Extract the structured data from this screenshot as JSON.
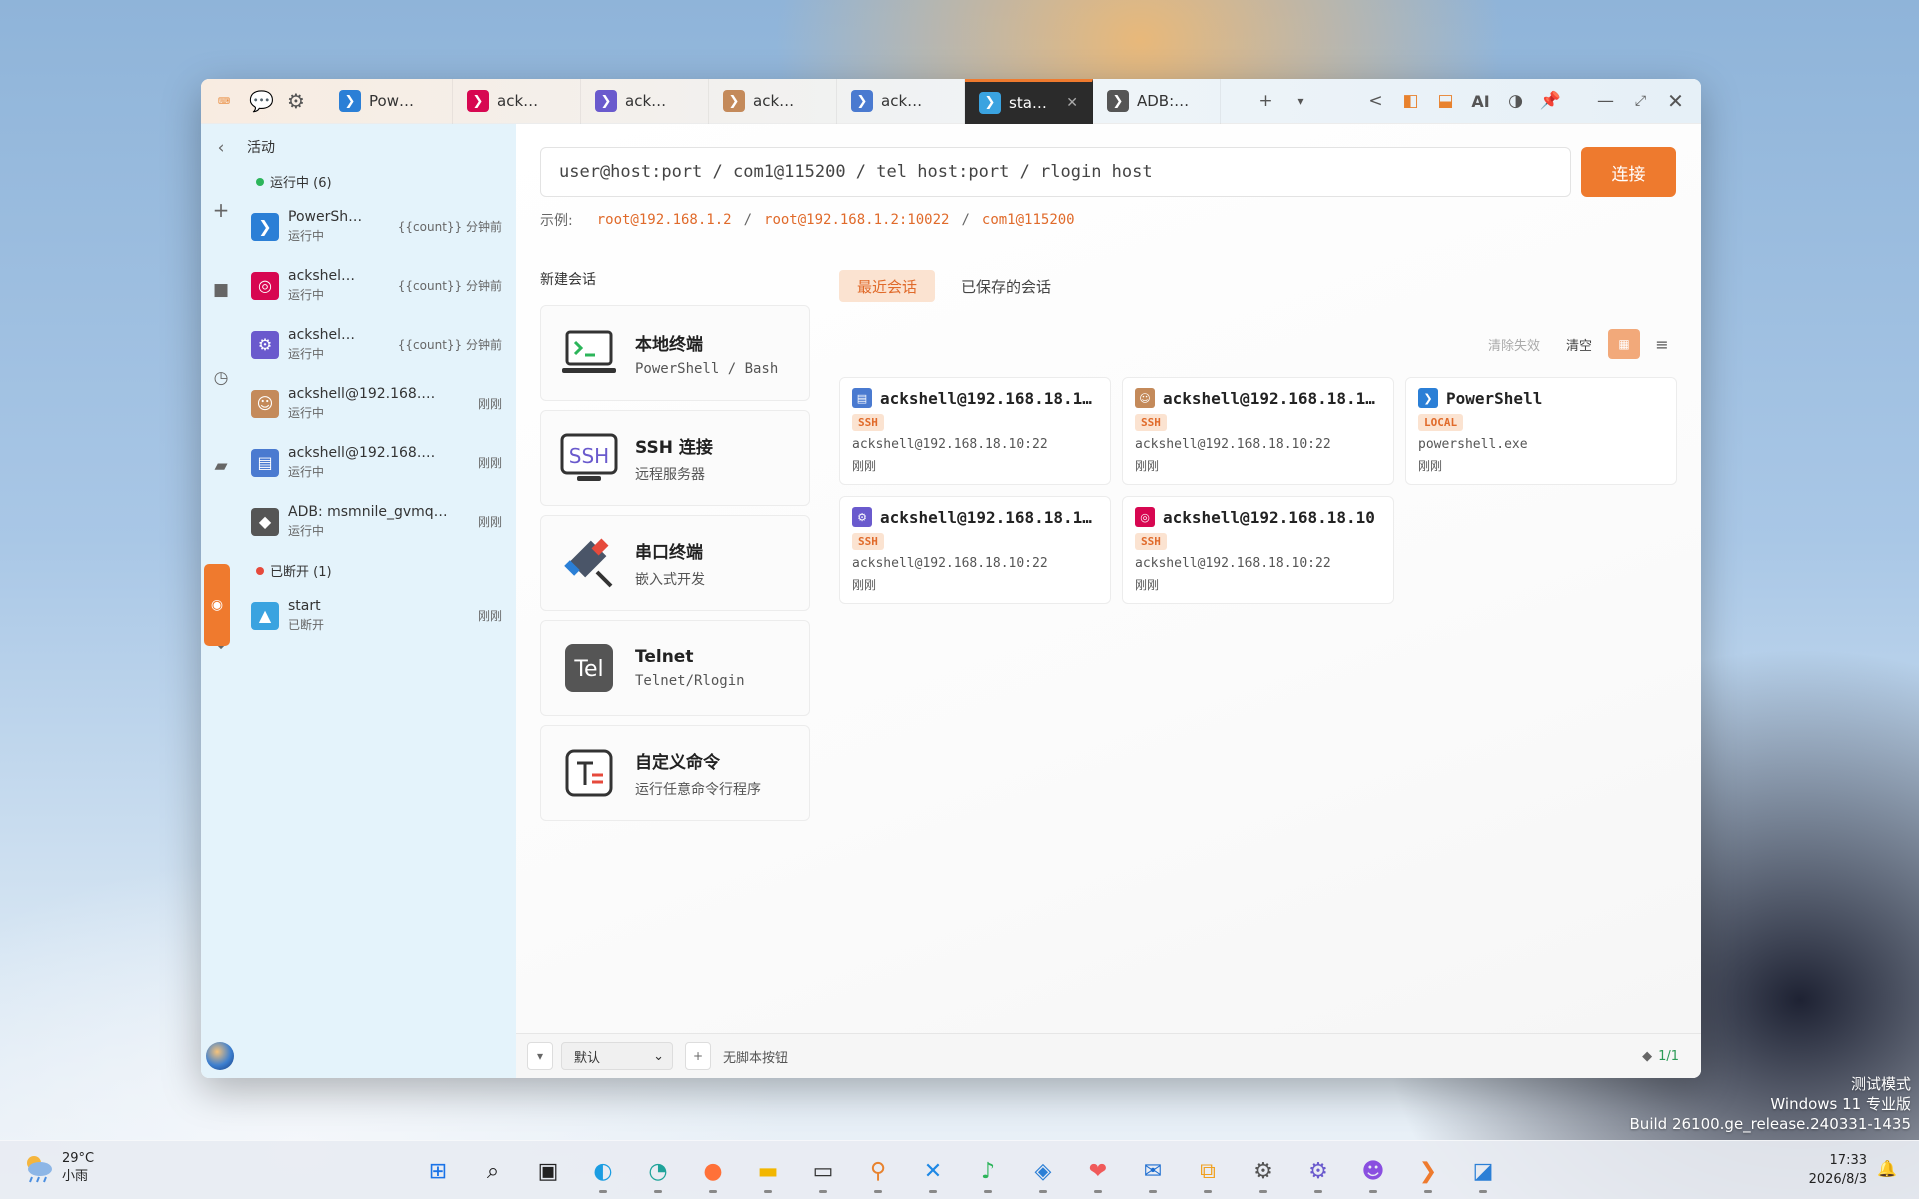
{
  "titlebar": {
    "icons": [
      "terminal-icon",
      "chat-icon",
      "gear-icon"
    ],
    "tabs": [
      {
        "label": "Pow…",
        "icon": "powershell-icon",
        "color": "#2b7fd6"
      },
      {
        "label": "ack…",
        "icon": "debian-icon",
        "color": "#d70751"
      },
      {
        "label": "ack…",
        "icon": "network-icon",
        "color": "#6a5acd"
      },
      {
        "label": "ack…",
        "icon": "avatar-icon",
        "color": "#c48a5a"
      },
      {
        "label": "ack…",
        "icon": "monitor-icon",
        "color": "#4a7ad0"
      },
      {
        "label": "sta…",
        "icon": "start-icon",
        "color": "#3aa3e0",
        "active": true
      },
      {
        "label": "ADB:…",
        "icon": "android-icon",
        "color": "#555555"
      }
    ],
    "right_buttons": {
      "add": "+",
      "dropdown": "▾",
      "back": "<",
      "ai": "AI"
    }
  },
  "sidebar": {
    "header": "活动",
    "running_title": "运行中 (6)",
    "running": [
      {
        "name": "PowerSh…",
        "status": "运行中",
        "time": "{{count}} 分钟前",
        "color": "#2b7fd6",
        "glyph": "❯"
      },
      {
        "name": "ackshel…",
        "status": "运行中",
        "time": "{{count}} 分钟前",
        "color": "#d70751",
        "glyph": "◎"
      },
      {
        "name": "ackshel…",
        "status": "运行中",
        "time": "{{count}} 分钟前",
        "color": "#6a5acd",
        "glyph": "⚙"
      },
      {
        "name": "ackshell@192.168.…",
        "status": "运行中",
        "time": "刚刚",
        "color": "#c48a5a",
        "glyph": "☺"
      },
      {
        "name": "ackshell@192.168.…",
        "status": "运行中",
        "time": "刚刚",
        "color": "#4a7ad0",
        "glyph": "▤"
      },
      {
        "name": "ADB: msmnile_gvmq…",
        "status": "运行中",
        "time": "刚刚",
        "color": "#555555",
        "glyph": "◆"
      }
    ],
    "disconnected_title": "已断开 (1)",
    "disconnected": [
      {
        "name": "start",
        "status": "已断开",
        "time": "刚刚",
        "color": "#3aa3e0",
        "glyph": "▲"
      }
    ],
    "running_dot": "#2cb55a",
    "disconnected_dot": "#e64a3c"
  },
  "main": {
    "input_placeholder": "user@host:port / com1@115200 / tel host:port / rlogin host",
    "connect_label": "连接",
    "examples_label": "示例:",
    "examples": [
      "root@192.168.1.2",
      "root@192.168.1.2:10022",
      "com1@115200"
    ],
    "separator": "/",
    "new_session_title": "新建会话",
    "new_sessions": [
      {
        "title": "本地终端",
        "sub": "PowerShell / Bash",
        "icon": "laptop-terminal-icon"
      },
      {
        "title": "SSH 连接",
        "sub": "远程服务器",
        "icon": "ssh-icon"
      },
      {
        "title": "串口终端",
        "sub": "嵌入式开发",
        "icon": "serial-plug-icon"
      },
      {
        "title": "Telnet",
        "sub": "Telnet/Rlogin",
        "icon": "telnet-icon"
      },
      {
        "title": "自定义命令",
        "sub": "运行任意命令行程序",
        "icon": "custom-command-icon"
      }
    ],
    "session_tabs": [
      "最近会话",
      "已保存的会话"
    ],
    "clear_invalid": "清除失效",
    "clear": "清空",
    "recent": [
      {
        "name": "ackshell@192.168.18.10…",
        "badge": "SSH",
        "addr": "ackshell@192.168.18.10:22",
        "time": "刚刚",
        "color": "#4a7ad0",
        "glyph": "▤"
      },
      {
        "name": "ackshell@192.168.18.10…",
        "badge": "SSH",
        "addr": "ackshell@192.168.18.10:22",
        "time": "刚刚",
        "color": "#c48a5a",
        "glyph": "☺"
      },
      {
        "name": "PowerShell",
        "badge": "LOCAL",
        "addr": "powershell.exe",
        "time": "刚刚",
        "color": "#2b7fd6",
        "glyph": "❯"
      },
      {
        "name": "ackshell@192.168.18.10…",
        "badge": "SSH",
        "addr": "ackshell@192.168.18.10:22",
        "time": "刚刚",
        "color": "#6a5acd",
        "glyph": "⚙"
      },
      {
        "name": "ackshell@192.168.18.10",
        "badge": "SSH",
        "addr": "ackshell@192.168.18.10:22",
        "time": "刚刚",
        "color": "#d70751",
        "glyph": "◎"
      }
    ]
  },
  "bottombar": {
    "profile": "默认",
    "no_script": "无脚本按钮",
    "page": "1/1"
  },
  "desktop": {
    "watermark_line1": "测试模式",
    "watermark_line2": "Windows 11 专业版",
    "watermark_line3": "Build 26100.ge_release.240331-1435"
  },
  "taskbar": {
    "temperature": "29°C",
    "weather": "小雨",
    "time": "17:33",
    "date": "2026/8/3",
    "apps": [
      {
        "name": "start-icon",
        "glyph": "⊞",
        "color": "#1a73e8"
      },
      {
        "name": "search-icon",
        "glyph": "⌕",
        "color": "#222222"
      },
      {
        "name": "task-view-icon",
        "glyph": "▣",
        "color": "#222222"
      },
      {
        "name": "edge-icon",
        "glyph": "◐",
        "color": "#1b9de2"
      },
      {
        "name": "browser-wave-icon",
        "glyph": "◔",
        "color": "#1fa39a"
      },
      {
        "name": "firefox-icon",
        "glyph": "●",
        "color": "#ff7139"
      },
      {
        "name": "file-explorer-icon",
        "glyph": "▬",
        "color": "#f2b600"
      },
      {
        "name": "terminal-icon",
        "glyph": "▭",
        "color": "#333333"
      },
      {
        "name": "search-tool-icon",
        "glyph": "⚲",
        "color": "#e8822e"
      },
      {
        "name": "vscode-icon",
        "glyph": "✕",
        "color": "#1e88e5"
      },
      {
        "name": "music-icon",
        "glyph": "♪",
        "color": "#2cb55a"
      },
      {
        "name": "shield-icon",
        "glyph": "◈",
        "color": "#2b7fd6"
      },
      {
        "name": "app-heart-icon",
        "glyph": "❤",
        "color": "#f05a5a"
      },
      {
        "name": "outlook-icon",
        "glyph": "✉",
        "color": "#1c6dd0"
      },
      {
        "name": "remote-desktop-icon",
        "glyph": "⧉",
        "color": "#f0a020"
      },
      {
        "name": "settings-icon",
        "glyph": "⚙",
        "color": "#555555"
      },
      {
        "name": "network-tool-icon",
        "glyph": "⚙",
        "color": "#6a5acd"
      },
      {
        "name": "cat-app-icon",
        "glyph": "☻",
        "color": "#8a4fe0"
      },
      {
        "name": "ackshell-icon",
        "glyph": "❯",
        "color": "#ee7a2e"
      },
      {
        "name": "photos-icon",
        "glyph": "◪",
        "color": "#2b7fd6"
      }
    ]
  }
}
